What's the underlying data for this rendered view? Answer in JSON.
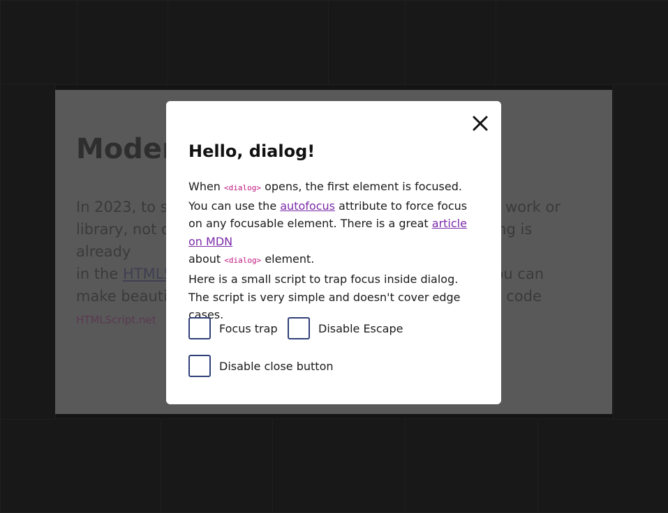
{
  "background": {
    "title": "Moder",
    "paragraph": [
      {
        "text": "In 2023, to sh"
      },
      {
        "text": "work or"
      },
      {
        "text": "library, not do"
      },
      {
        "text": "ng is already"
      },
      {
        "text": "in the "
      },
      {
        "text": "HTML5"
      },
      {
        "text": ". you can"
      },
      {
        "text": "make beautif"
      },
      {
        "text": "n code"
      },
      {
        "text": "HTMLScript.net"
      }
    ]
  },
  "dialog": {
    "title": "Hello, dialog!",
    "close_icon": "close-icon",
    "p1": {
      "t1": "When ",
      "code1": "<dialog>",
      "t2": " opens, the first element is focused. You can use the ",
      "link1": "autofocus",
      "t3": " attribute to force focus on any focusable element. There is a great ",
      "link2": "article on MDN",
      "t4": " about ",
      "code2": "<dialog>",
      "t5": " element."
    },
    "p2": "Here is a small script to trap focus inside dialog. The script is very simple and doesn't cover edge cases.",
    "checkboxes": [
      {
        "label": "Focus trap",
        "checked": false
      },
      {
        "label": "Disable Escape",
        "checked": false
      },
      {
        "label": "Disable close button",
        "checked": false
      }
    ]
  }
}
